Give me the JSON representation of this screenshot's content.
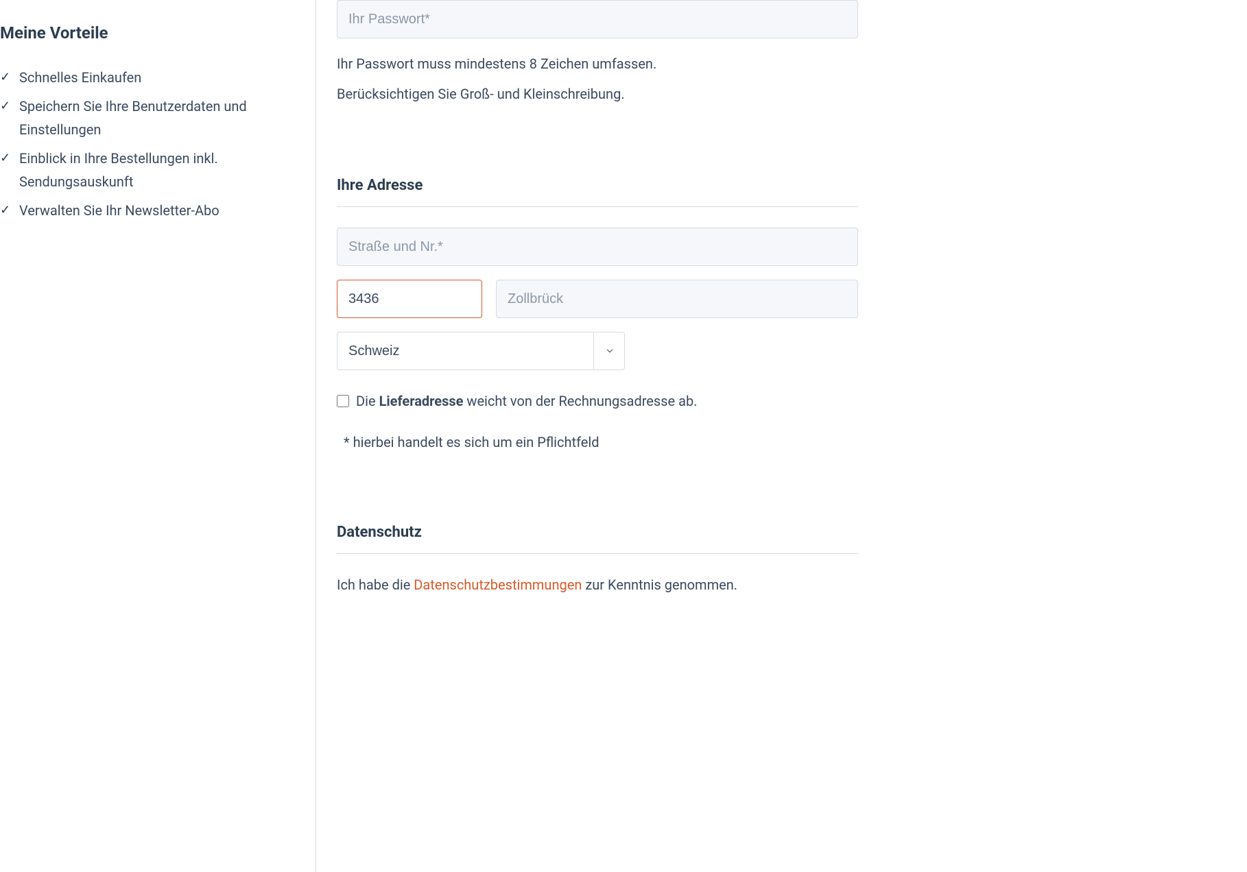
{
  "sidebar": {
    "title": "Meine Vorteile",
    "benefits": [
      "Schnelles Einkaufen",
      "Speichern Sie Ihre Benutzerdaten und Einstellungen",
      "Einblick in Ihre Bestellungen inkl. Sendungsauskunft",
      "Verwalten Sie Ihr Newsletter-Abo"
    ]
  },
  "form": {
    "password": {
      "placeholder": "Ihr Passwort*",
      "help_line1": "Ihr Passwort muss mindestens 8 Zeichen umfassen.",
      "help_line2": "Berücksichtigen Sie Groß- und Kleinschreibung."
    },
    "address": {
      "heading": "Ihre Adresse",
      "street_placeholder": "Straße und Nr.*",
      "zip_value": "3436",
      "city_placeholder": "Zollbrück",
      "country_value": "Schweiz",
      "shipping_diff_pre": "Die ",
      "shipping_diff_bold": "Lieferadresse",
      "shipping_diff_post": " weicht von der Rechnungsadresse ab.",
      "required_note": "* hierbei handelt es sich um ein Pflichtfeld"
    },
    "privacy": {
      "heading": "Datenschutz",
      "text_pre": "Ich habe die ",
      "link": "Datenschutzbestimmungen",
      "text_post": " zur Kenntnis genommen."
    }
  }
}
